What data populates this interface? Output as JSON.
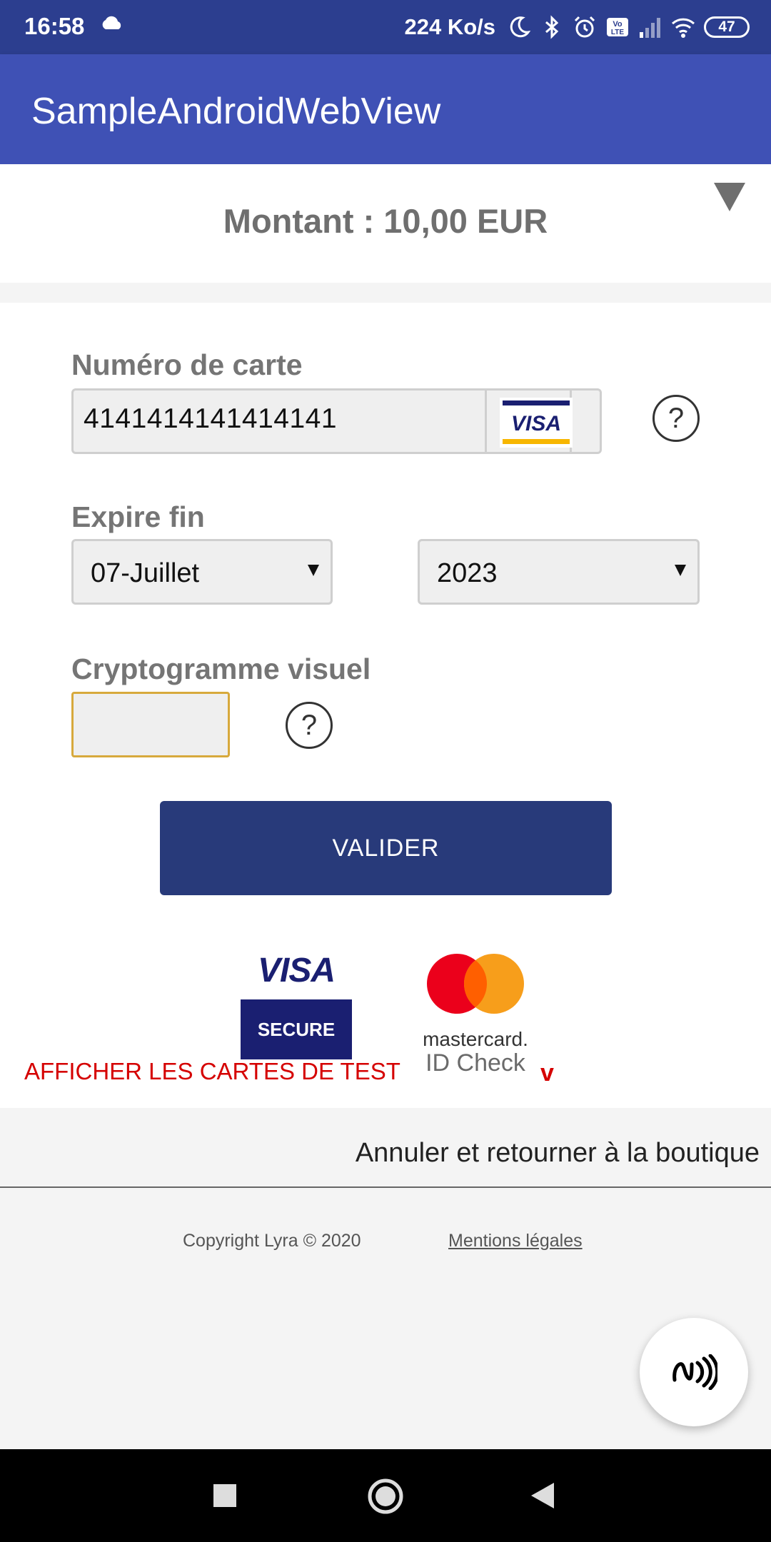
{
  "status_bar": {
    "time": "16:58",
    "net_speed": "224 Ko/s",
    "battery": "47",
    "icons": [
      "cloud-icon",
      "moon-icon",
      "bluetooth-icon",
      "alarm-icon",
      "volte-icon",
      "signal-icon",
      "wifi-icon",
      "battery-icon"
    ]
  },
  "app_bar": {
    "title": "SampleAndroidWebView"
  },
  "amount": {
    "text": "Montant : 10,00 EUR"
  },
  "form": {
    "card_number_label": "Numéro de carte",
    "card_number_value": "4141414141414141",
    "card_brand": "VISA",
    "card_help": "?",
    "expiry_label": "Expire fin",
    "expiry_month": "07-Juillet",
    "expiry_year": "2023",
    "cvv_label": "Cryptogramme visuel",
    "cvv_value": "",
    "cvv_help": "?",
    "submit_label": "VALIDER"
  },
  "logos": {
    "visa_word": "VISA",
    "visa_secure": "SECURE",
    "mastercard_word": "mastercard.",
    "mastercard_id_check": "ID Check"
  },
  "test_cards": {
    "label": "AFFICHER LES CARTES DE TEST",
    "chevron": "v"
  },
  "footer": {
    "cancel": "Annuler et retourner à la boutique",
    "copyright": "Copyright Lyra © 2020",
    "legal": "Mentions légales"
  },
  "colors": {
    "status_bar": "#2c3e8f",
    "app_bar": "#3f51b5",
    "button": "#283a7a",
    "link_red": "#d50000",
    "cvv_focus": "#d7a93c"
  }
}
